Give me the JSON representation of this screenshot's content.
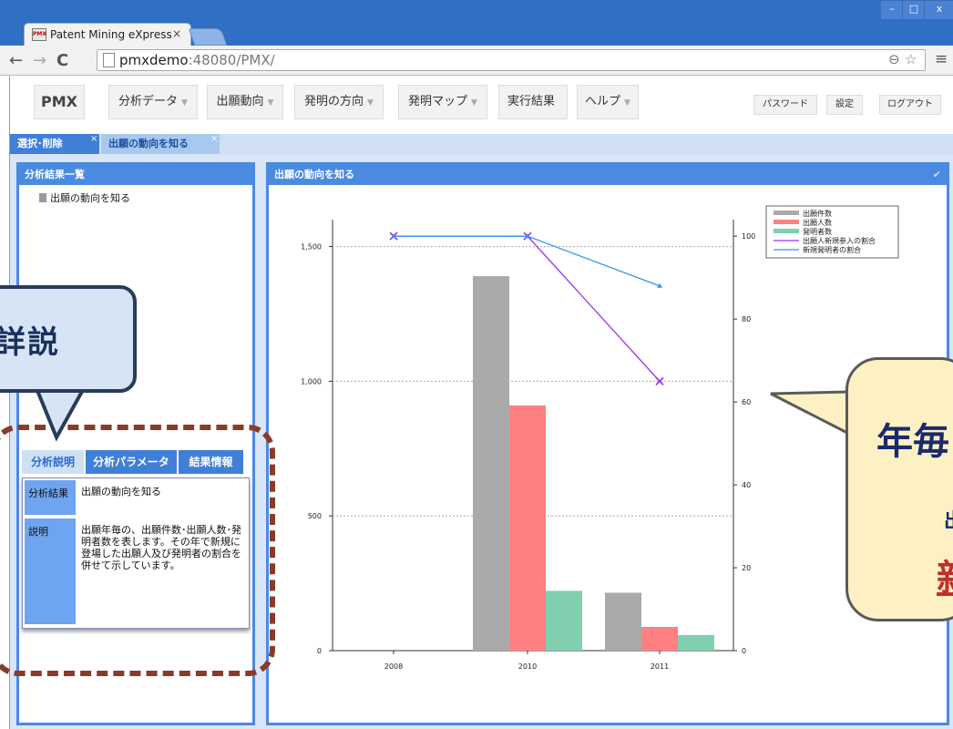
{
  "browser": {
    "tab_title": "Patent Mining eXpress",
    "tab_close": "×",
    "favicon_text": "PMX",
    "url_host": "pmxdemo",
    "url_rest": ":48080/PMX/",
    "window_controls": [
      "–",
      "□",
      "x"
    ],
    "nav": {
      "back": "←",
      "forward": "→",
      "reload": "C"
    },
    "icons": {
      "zoom": "⊖",
      "star": "☆",
      "menu": "≡"
    }
  },
  "app_nav": {
    "brand": "PMX",
    "menus": [
      {
        "label": "分析データ",
        "caret": "▼"
      },
      {
        "label": "出願動向",
        "caret": "▼"
      },
      {
        "label": "発明の方向",
        "caret": "▼"
      },
      {
        "label": "発明マップ",
        "caret": "▼"
      },
      {
        "label": "実行結果",
        "caret": ""
      },
      {
        "label": "ヘルプ",
        "caret": "▼"
      }
    ],
    "password": "パスワード",
    "settings": "設定",
    "logout": "ログアウト"
  },
  "subtabs": [
    {
      "label": "選択･削除",
      "close": "×"
    },
    {
      "label": "出願の動向を知る",
      "close": "×"
    }
  ],
  "left_panel": {
    "title": "分析結果一覧",
    "items": [
      "出願の動向を知る"
    ]
  },
  "desc": {
    "tabs": [
      "分析説明",
      "分析パラメータ",
      "結果情報"
    ],
    "rows": [
      {
        "label": "分析結果",
        "value": "出願の動向を知る"
      },
      {
        "label": "説明",
        "value": "出願年毎の、出願件数･出願人数･発明者数を表します。その年で新規に登場した出願人及び発明者の割合を併せて示しています。"
      }
    ]
  },
  "chart_panel": {
    "title": "出願の動向を知る",
    "check_icon": "✔"
  },
  "chart_data": {
    "type": "bar",
    "categories": [
      "2008",
      "2010",
      "2011"
    ],
    "series": [
      {
        "name": "出願件数",
        "kind": "bar",
        "axis": "left",
        "color": "#aaaaaa",
        "values": [
          0,
          1390,
          215
        ]
      },
      {
        "name": "出願人数",
        "kind": "bar",
        "axis": "left",
        "color": "#ff8080",
        "values": [
          0,
          910,
          88
        ]
      },
      {
        "name": "発明者数",
        "kind": "bar",
        "axis": "left",
        "color": "#80d0b0",
        "values": [
          0,
          222,
          58
        ]
      },
      {
        "name": "出願人新規参入の割合",
        "kind": "line",
        "axis": "right",
        "color": "#9933ee",
        "marker": "x",
        "values": [
          100,
          100,
          65
        ]
      },
      {
        "name": "新規発明者の割合",
        "kind": "line",
        "axis": "right",
        "color": "#3399ee",
        "marker": "triangle",
        "values": [
          100,
          100,
          88
        ]
      }
    ],
    "left_ticks": [
      "0",
      "500",
      "1,000",
      "1,500"
    ],
    "right_ticks": [
      "0",
      "20",
      "40",
      "60",
      "80",
      "100"
    ],
    "ylim_left": [
      0,
      1600
    ],
    "ylim_right": [
      0,
      104
    ],
    "grid": "dotted horizontal",
    "legend": "top-right"
  },
  "overlay": {
    "callout_left": "詳説",
    "callout_right_big": "年毎",
    "callout_right_small": "出",
    "callout_right_red": "新"
  }
}
